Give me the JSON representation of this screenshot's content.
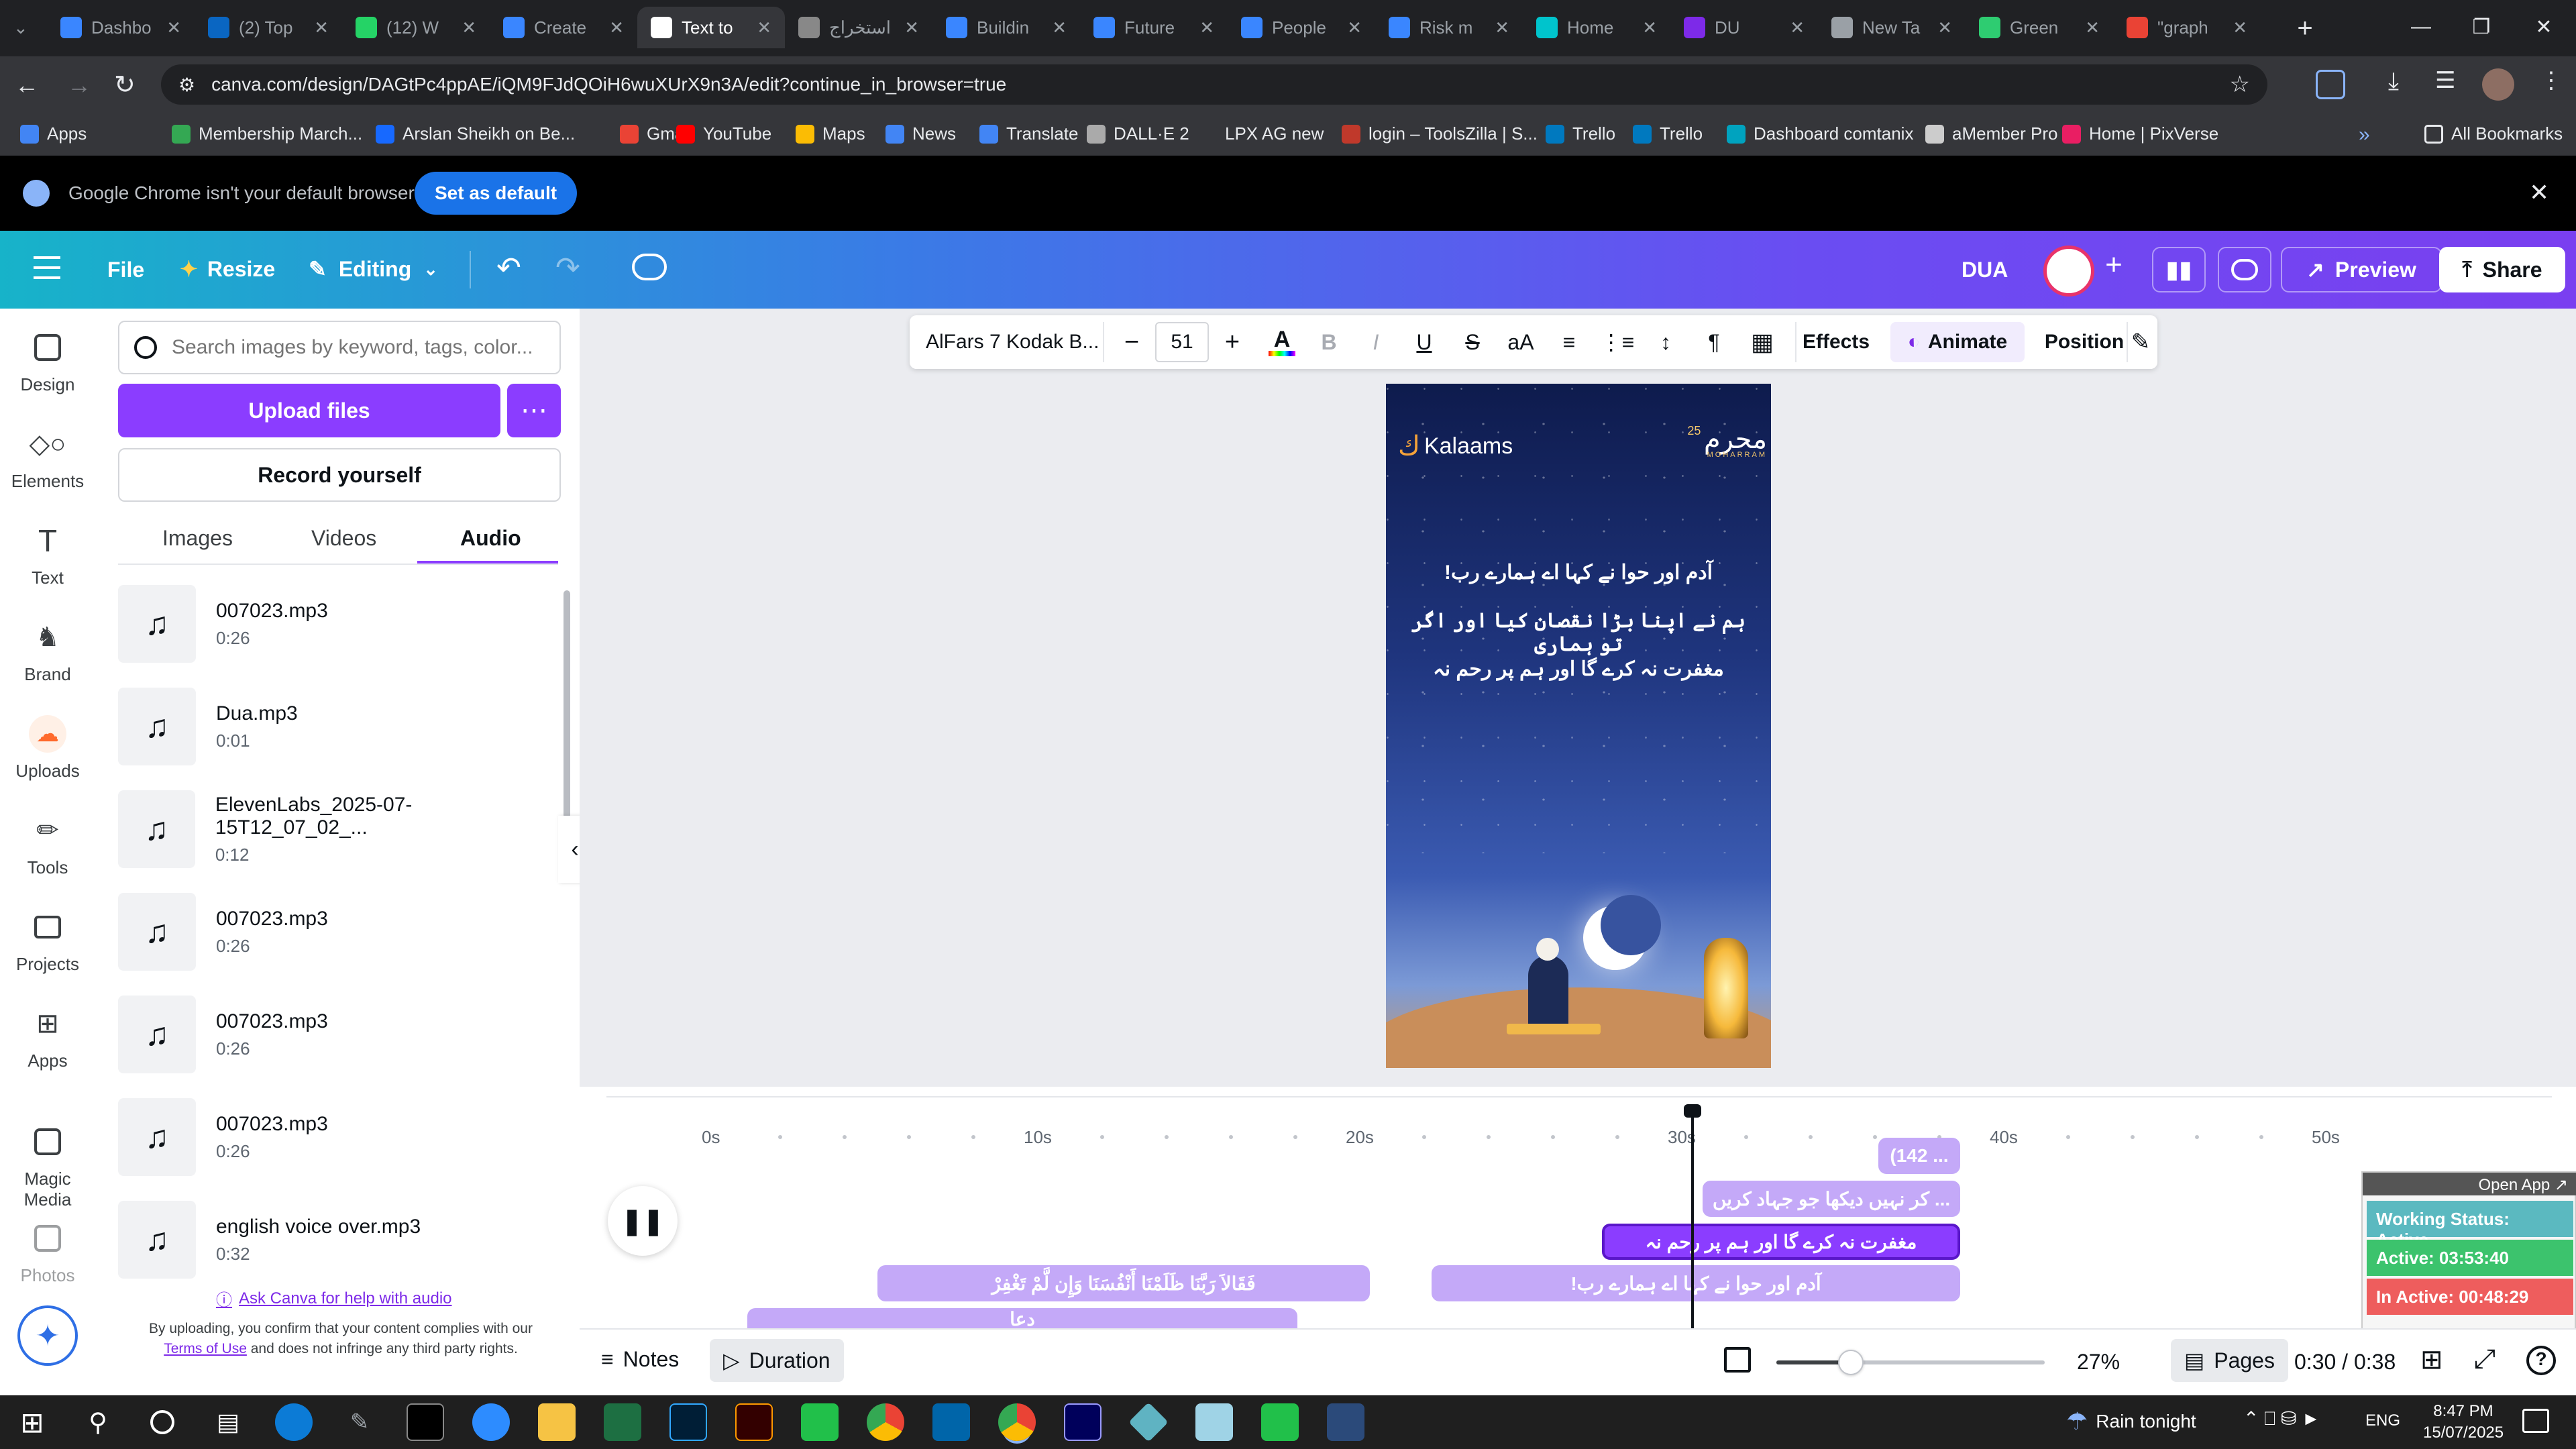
{
  "browser": {
    "tabs": [
      {
        "label": "Dashbo",
        "color": "#3a86ff"
      },
      {
        "label": "(2) Top",
        "color": "#0a66c2"
      },
      {
        "label": "(12) W",
        "color": "#25d366"
      },
      {
        "label": "Create",
        "color": "#3a86ff"
      },
      {
        "label": "Text to",
        "color": "#ffffff"
      },
      {
        "label": "استخراج",
        "color": "#888888"
      },
      {
        "label": "Buildin",
        "color": "#3a86ff"
      },
      {
        "label": "Future",
        "color": "#3a86ff"
      },
      {
        "label": "People",
        "color": "#3a86ff"
      },
      {
        "label": "Risk m",
        "color": "#3a86ff"
      },
      {
        "label": "Home",
        "color": "#00c4cc"
      },
      {
        "label": "DU",
        "color": "#7d2ae8"
      },
      {
        "label": "New Ta",
        "color": "#9aa0a6"
      },
      {
        "label": "Green",
        "color": "#2ecc71"
      },
      {
        "label": "\"graph",
        "color": "#ea4335"
      }
    ],
    "url": "canva.com/design/DAGtPc4ppAE/iQM9FJdQOiH6wuXUrX9n3A/edit?continue_in_browser=true",
    "bookmarks": [
      {
        "label": "Apps",
        "color": "#4285f4"
      },
      {
        "label": "Membership March...",
        "color": "#34a853"
      },
      {
        "label": "Arslan Sheikh on Be...",
        "color": "#1769ff"
      },
      {
        "label": "Gmail",
        "color": "#ea4335"
      },
      {
        "label": "YouTube",
        "color": "#ff0000"
      },
      {
        "label": "Maps",
        "color": "#fbbc04"
      },
      {
        "label": "News",
        "color": "#4285f4"
      },
      {
        "label": "Translate",
        "color": "#4285f4"
      },
      {
        "label": "DALL·E 2",
        "color": "#aaaaaa"
      },
      {
        "label": "LPX AG new",
        "color": "#35363a"
      },
      {
        "label": "login – ToolsZilla | S...",
        "color": "#c0392b"
      },
      {
        "label": "Trello",
        "color": "#0079bf"
      },
      {
        "label": "Trello",
        "color": "#0079bf"
      },
      {
        "label": "Dashboard comtanix",
        "color": "#00a3bf"
      },
      {
        "label": "aMember Pro",
        "color": "#cccccc"
      },
      {
        "label": "Home | PixVerse",
        "color": "#e91e63"
      }
    ],
    "all_bookmarks": "All Bookmarks",
    "notice": "Google Chrome isn't your default browser",
    "set_default": "Set as default"
  },
  "canva": {
    "file": "File",
    "resize": "Resize",
    "editing": "Editing",
    "title": "DUA",
    "preview": "Preview",
    "share": "Share",
    "rail": [
      "Design",
      "Elements",
      "Text",
      "Brand",
      "Uploads",
      "Tools",
      "Projects",
      "Apps",
      "Magic Media",
      "Photos"
    ],
    "search_placeholder": "Search images by keyword, tags, color...",
    "upload": "Upload files",
    "record": "Record yourself",
    "tabs": [
      "Images",
      "Videos",
      "Audio"
    ],
    "audio": [
      {
        "name": "007023.mp3",
        "dur": "0:26"
      },
      {
        "name": "Dua.mp3",
        "dur": "0:01"
      },
      {
        "name": "ElevenLabs_2025-07-15T12_07_02_...",
        "dur": "0:12"
      },
      {
        "name": "007023.mp3",
        "dur": "0:26"
      },
      {
        "name": "007023.mp3",
        "dur": "0:26"
      },
      {
        "name": "007023.mp3",
        "dur": "0:26"
      },
      {
        "name": "english voice over.mp3",
        "dur": "0:32"
      }
    ],
    "help": "Ask Canva for help with audio",
    "disclaimer_a": "By uploading, you confirm that your content complies with our",
    "terms": "Terms of Use",
    "disclaimer_b": "and does not infringe any third party rights.",
    "toolbar": {
      "font": "AlFars 7 Kodak B...",
      "size": "51",
      "effects": "Effects",
      "animate": "Animate",
      "position": "Position"
    },
    "slide": {
      "brand": "Kalaams",
      "badge": "محرم",
      "badge_num": "25",
      "badge_sub": "MOHARRAM",
      "lines": [
        "آدم اور حوا نے کہا اے ہمارے رب!",
        "ہم نے اپنا بڑا نقصان کیا اور اگر تو ہماری",
        "مغفرت نہ کرے گا اور ہم پر رحم نہ"
      ]
    },
    "timeline": {
      "ticks": [
        "0s",
        "10s",
        "20s",
        "30s",
        "40s",
        "50s"
      ],
      "clips": [
        "(142 ...",
        "... کر نہیں دیکھا جو جہاد کریں",
        "مغفرت نہ کرے گا اور ہم پر رحم نہ",
        "آدم اور حوا نے کہا اے ہمارے رب!",
        "فَقَالاَ رَبَّنَا ظَلَمْنَا أَنْفُسَنَا وَإِن لَّمْ تَغْفِرْ",
        "دعا"
      ]
    },
    "notes": "Notes",
    "duration": "Duration",
    "zoom": "27%",
    "pages": "Pages",
    "time": "0:30 / 0:38"
  },
  "overlay": {
    "open_app": "Open App ↗",
    "status": "Working Status: Active",
    "active": "Active: 03:53:40",
    "inactive": "In Active: 00:48:29"
  },
  "taskbar": {
    "weather": "Rain tonight",
    "lang": "ENG",
    "time": "8:47 PM",
    "date": "15/07/2025"
  }
}
